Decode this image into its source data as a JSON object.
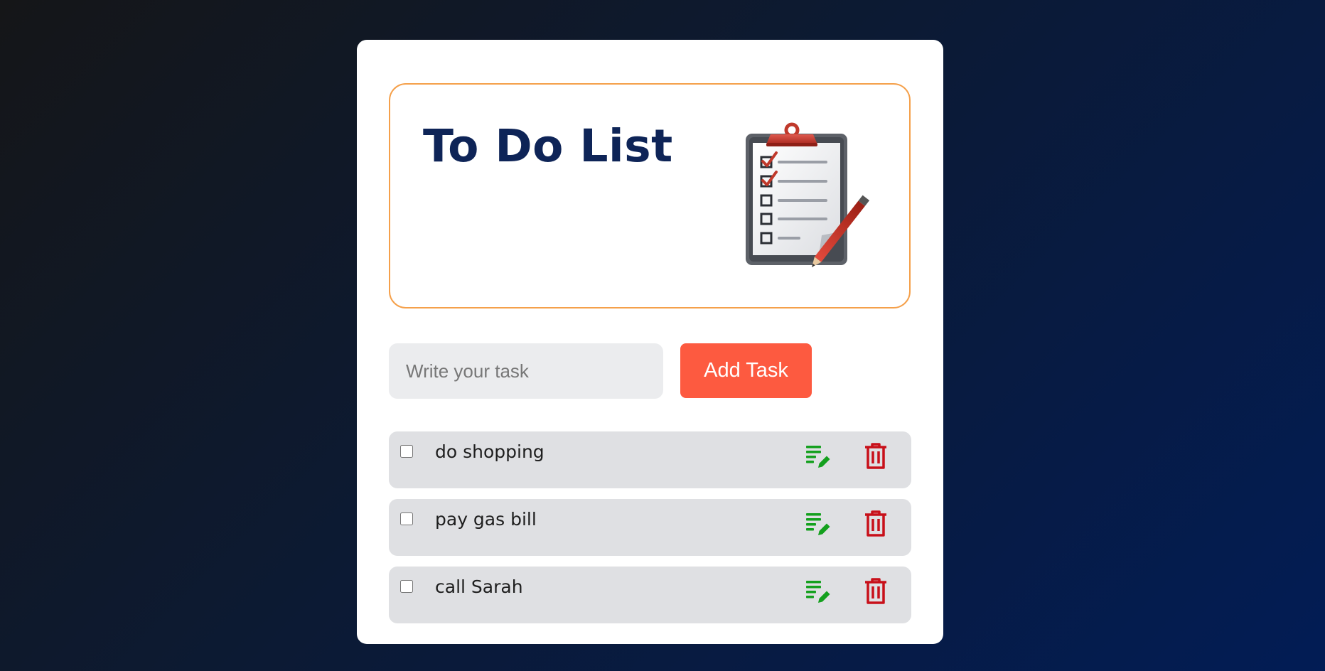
{
  "header": {
    "title": "To Do List",
    "illustration": "clipboard-checklist-icon"
  },
  "input": {
    "placeholder": "Write your task",
    "value": ""
  },
  "add_button": {
    "label": "Add Task"
  },
  "tasks": [
    {
      "text": "do shopping",
      "checked": false
    },
    {
      "text": "pay gas bill",
      "checked": false
    },
    {
      "text": "call Sarah",
      "checked": false
    }
  ],
  "icons": {
    "edit": "edit-list-icon",
    "delete": "trash-icon"
  },
  "colors": {
    "title": "#0e2457",
    "header_border": "#f5a04a",
    "add_button": "#fd5a40",
    "edit_icon": "#14a01e",
    "delete_icon": "#c8101a",
    "task_bg": "#dfe0e3"
  }
}
